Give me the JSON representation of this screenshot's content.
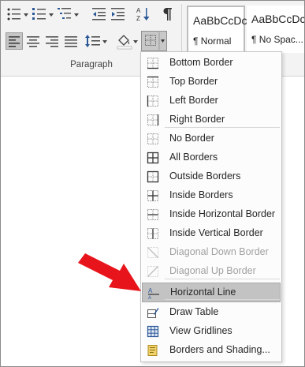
{
  "ribbon": {
    "group_label": "Paragraph",
    "styles": [
      {
        "sample": "AaBbCcDc",
        "name": "¶ Normal"
      },
      {
        "sample": "AaBbCcDc",
        "name": "¶ No Spac..."
      }
    ]
  },
  "menu": {
    "items": [
      {
        "label": "Bottom Border",
        "icon": "bottom-border-icon"
      },
      {
        "label": "Top Border",
        "icon": "top-border-icon"
      },
      {
        "label": "Left Border",
        "icon": "left-border-icon"
      },
      {
        "label": "Right Border",
        "icon": "right-border-icon"
      },
      {
        "label": "No Border",
        "icon": "no-border-icon"
      },
      {
        "label": "All Borders",
        "icon": "all-borders-icon"
      },
      {
        "label": "Outside Borders",
        "icon": "outside-borders-icon"
      },
      {
        "label": "Inside Borders",
        "icon": "inside-borders-icon"
      },
      {
        "label": "Inside Horizontal Border",
        "icon": "inside-horizontal-border-icon"
      },
      {
        "label": "Inside Vertical Border",
        "icon": "inside-vertical-border-icon"
      },
      {
        "label": "Diagonal Down Border",
        "icon": "diagonal-down-border-icon",
        "disabled": true
      },
      {
        "label": "Diagonal Up Border",
        "icon": "diagonal-up-border-icon",
        "disabled": true
      },
      {
        "label": "Horizontal Line",
        "icon": "horizontal-line-icon",
        "highlighted": true
      },
      {
        "label": "Draw Table",
        "icon": "draw-table-icon"
      },
      {
        "label": "View Gridlines",
        "icon": "view-gridlines-icon"
      },
      {
        "label": "Borders and Shading...",
        "icon": "borders-and-shading-icon"
      }
    ]
  },
  "colors": {
    "arrow": "#e8141b",
    "highlight": "#c3c3c3",
    "ribbon_bg": "#f3f3f3"
  }
}
